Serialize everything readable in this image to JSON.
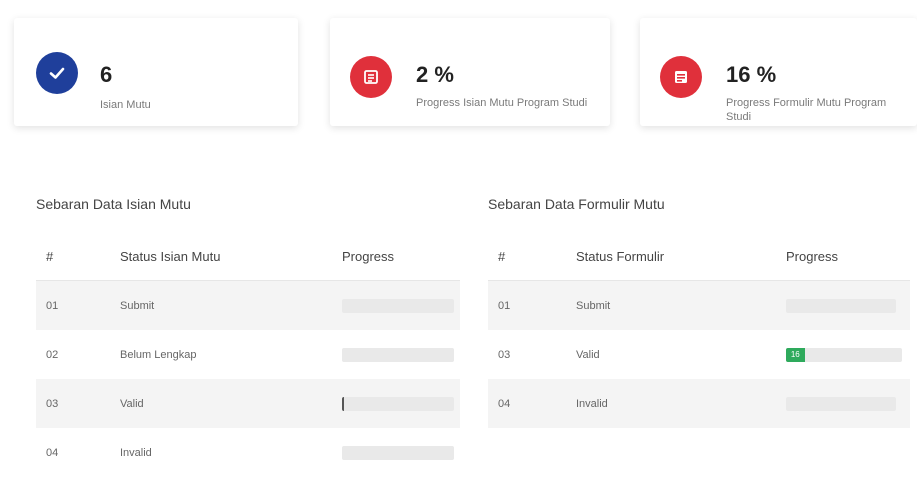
{
  "cards": [
    {
      "value": "6",
      "label": "Isian Mutu",
      "icon": "check-icon",
      "color": "#1f3f9b"
    },
    {
      "value": "2 %",
      "label": "Progress Isian Mutu Program Studi",
      "icon": "list-icon",
      "color": "#e0303b"
    },
    {
      "value": "16 %",
      "label": "Progress Formulir Mutu Program Studi",
      "icon": "form-icon",
      "color": "#e0303b"
    }
  ],
  "left_table": {
    "title": "Sebaran Data Isian Mutu",
    "headers": [
      "#",
      "Status Isian Mutu",
      "Progress"
    ],
    "rows": [
      {
        "num": "01",
        "status": "Submit",
        "progress": 0
      },
      {
        "num": "02",
        "status": "Belum Lengkap",
        "progress": 0
      },
      {
        "num": "03",
        "status": "Valid",
        "progress": 0.02
      },
      {
        "num": "04",
        "status": "Invalid",
        "progress": 0
      }
    ]
  },
  "right_table": {
    "title": "Sebaran Data Formulir Mutu",
    "headers": [
      "#",
      "Status Formulir",
      "Progress"
    ],
    "rows": [
      {
        "num": "01",
        "status": "Submit",
        "progress": 0
      },
      {
        "num": "03",
        "status": "Valid",
        "progress": 0.16,
        "progress_label": "16"
      },
      {
        "num": "04",
        "status": "Invalid",
        "progress": 0
      }
    ]
  }
}
